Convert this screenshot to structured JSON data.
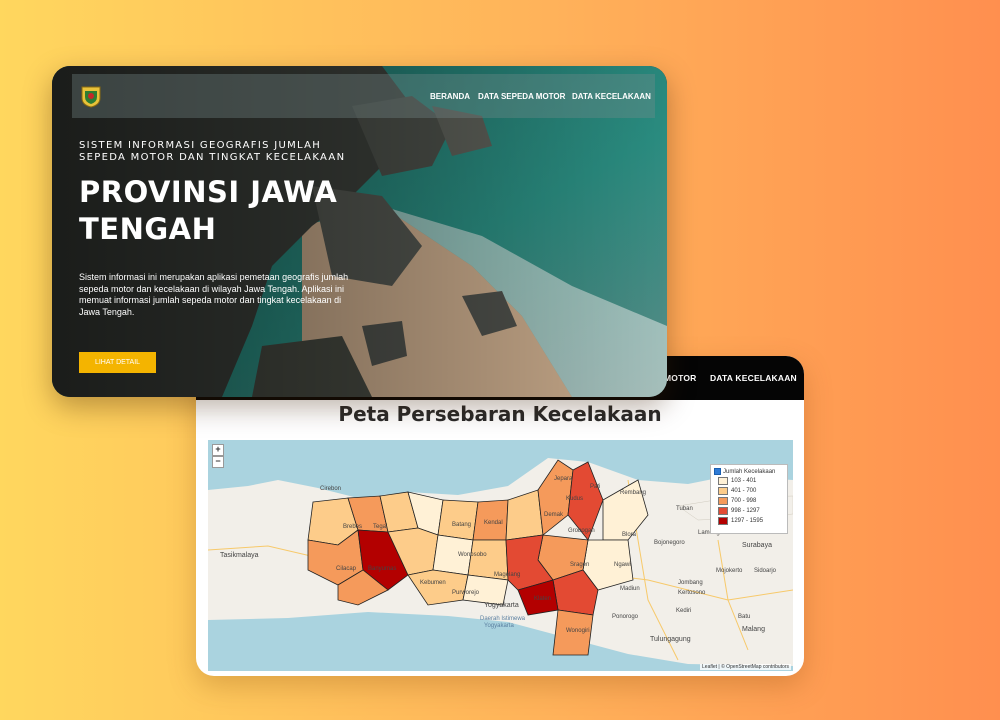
{
  "map_page": {
    "nav": [
      "MOTOR",
      "DATA KECELAKAAN"
    ],
    "title": "Peta Persebaran Kecelakaan",
    "zoom": {
      "in": "+",
      "out": "−"
    },
    "legend": {
      "title": "Jumlah Kecelakaan",
      "items": [
        {
          "label": "103 - 401",
          "color": "#fff1d6"
        },
        {
          "label": "401 - 700",
          "color": "#fdcc8a"
        },
        {
          "label": "700 - 998",
          "color": "#f59a5b"
        },
        {
          "label": "998 - 1297",
          "color": "#e34a33"
        },
        {
          "label": "1297 - 1595",
          "color": "#b30000"
        }
      ]
    },
    "places": {
      "cirebon": "Cirebon",
      "tasikmalaya": "Tasikmalaya",
      "brebes": "Brebes",
      "tegal": "Tegal",
      "batang": "Batang",
      "kendal": "Kendal",
      "jepara": "Jepara",
      "pati": "Pati",
      "rembang": "Rembang",
      "kudus": "Kudus",
      "demak": "Demak",
      "grobogan": "Grobogan",
      "blora": "Blora",
      "tuban": "Tuban",
      "bojonegoro": "Bojonegoro",
      "lamongan": "Lamongan",
      "surabaya": "Surabaya",
      "sragen": "Sragen",
      "ngawi": "Ngawi",
      "mojokerto": "Mojokerto",
      "sidoarjo": "Sidoarjo",
      "jombang": "Jombang",
      "kertosono": "Kertosono",
      "madiun": "Madiun",
      "kediri": "Kediri",
      "batu": "Batu",
      "malang": "Malang",
      "ponorogo": "Ponorogo",
      "tulungagung": "Tulungagung",
      "cilacap": "Cilacap",
      "banyumas": "Banyumas",
      "wonosobo": "Wonosobo",
      "magelang": "Magelang",
      "kebumen": "Kebumen",
      "purworejo": "Purworejo",
      "yogyakarta": "Yogyakarta",
      "klaten": "Klaten",
      "wonogiri": "Wonogiri",
      "daerah": "Daerah Istimewa",
      "daerah2": "Yogyakarta"
    },
    "attribution": "Leaflet | © OpenStreetMap contributors"
  },
  "hero_page": {
    "nav": [
      "BERANDA",
      "DATA SEPEDA MOTOR",
      "DATA KECELAKAAN"
    ],
    "eyebrow": "SISTEM INFORMASI GEOGRAFIS JUMLAH SEPEDA MOTOR DAN TINGKAT KECELAKAAN",
    "title": "PROVINSI JAWA TENGAH",
    "description": "Sistem informasi ini merupakan aplikasi pemetaan geografis jumlah sepeda motor dan kecelakaan di wilayah Jawa Tengah. Aplikasi ini memuat informasi jumlah sepeda motor dan tingkat kecelakaan di Jawa Tengah.",
    "cta": "LIHAT DETAIL"
  },
  "colors": {
    "accent": "#f4b400",
    "nav_dark": "#050505"
  }
}
